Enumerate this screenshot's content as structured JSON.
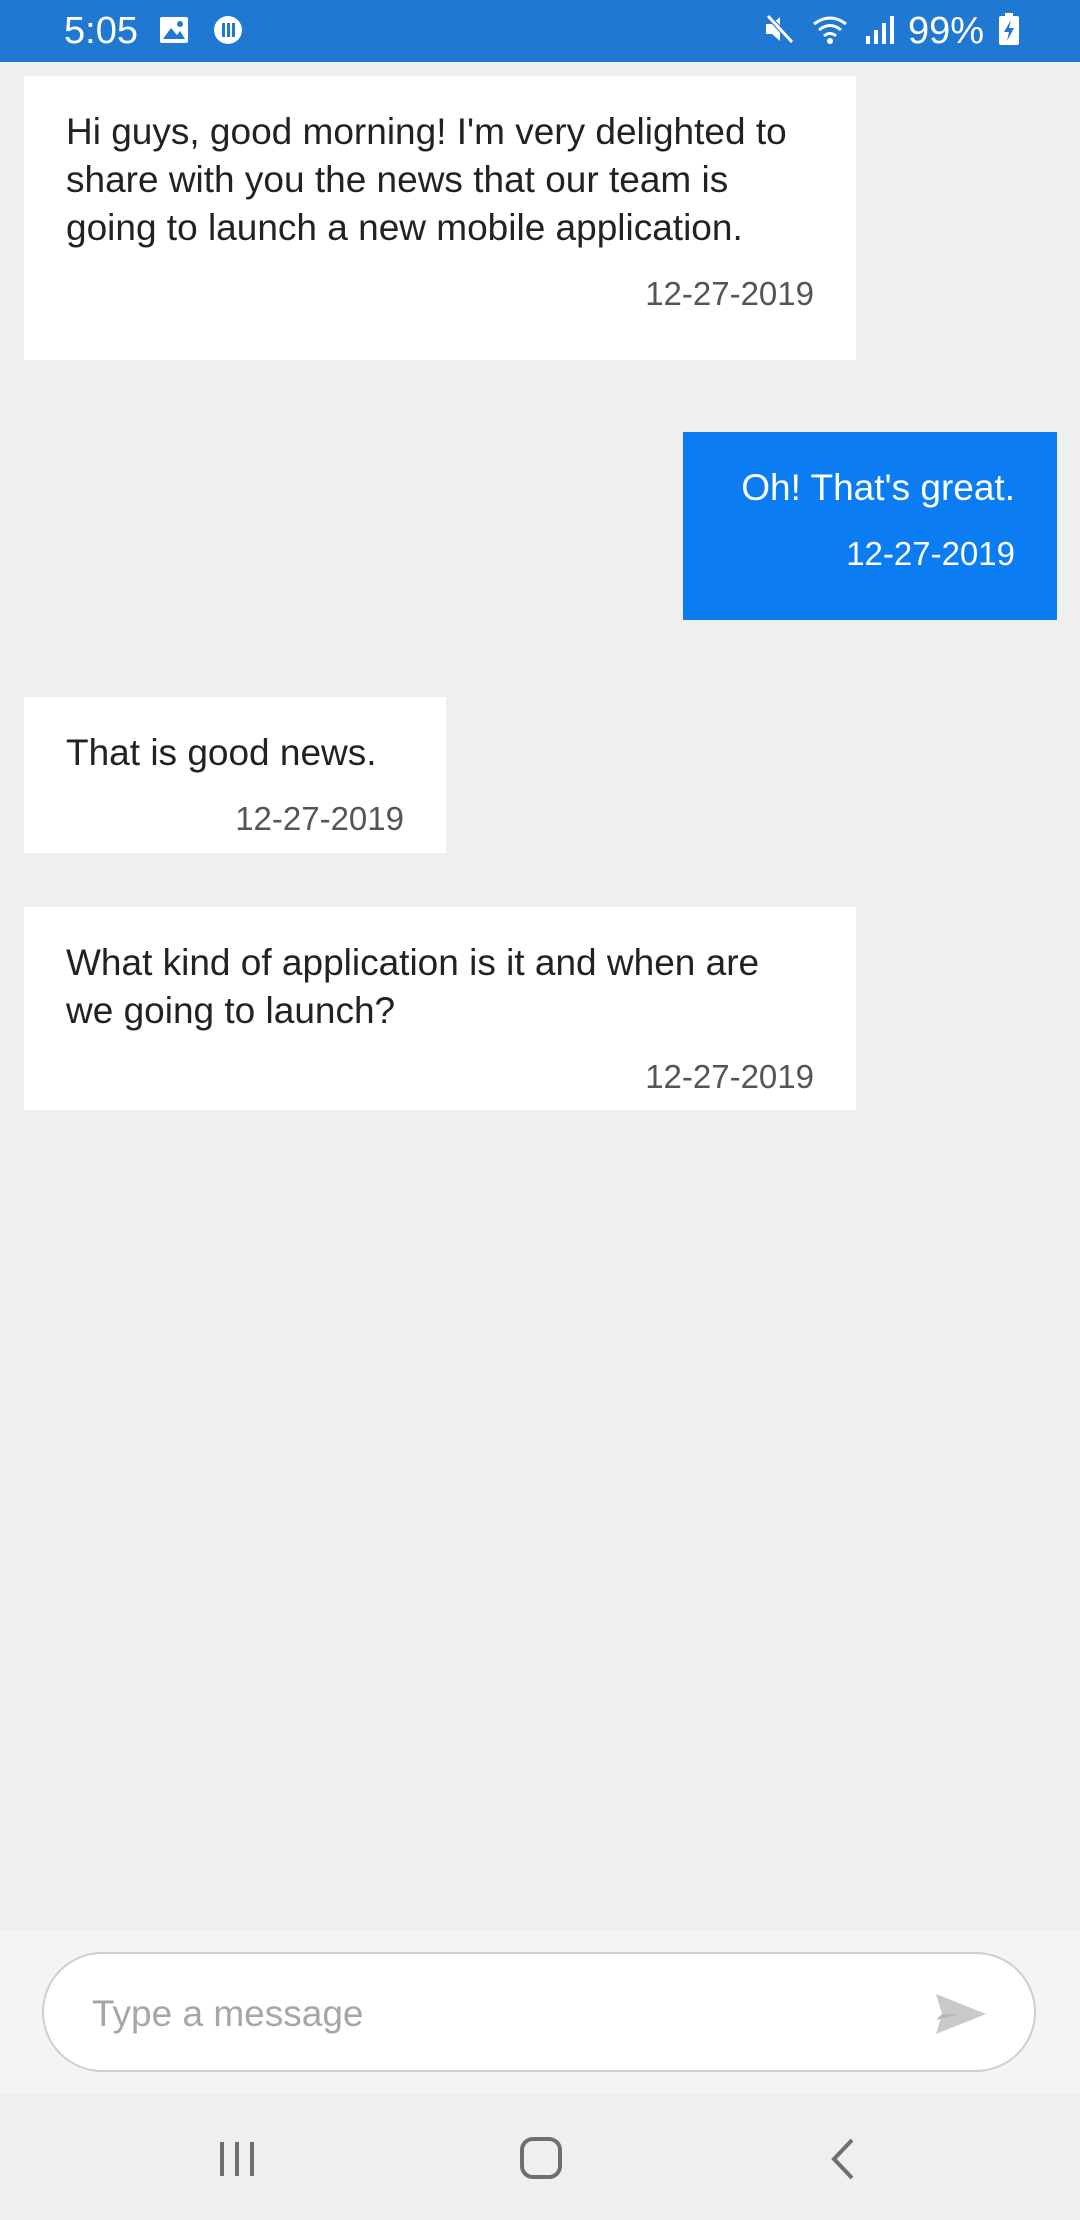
{
  "status_bar": {
    "time": "5:05",
    "battery_text": "99%",
    "color": "#1f78d1",
    "icons": [
      "gallery-icon",
      "notification-app-icon",
      "mute-icon",
      "wifi-icon",
      "signal-icon",
      "battery-charging-icon"
    ]
  },
  "messages": [
    {
      "direction": "incoming",
      "text": "Hi guys, good morning! I'm very delighted to share with you the news that our team is going to launch a new mobile application.",
      "date": "12-27-2019"
    },
    {
      "direction": "outgoing",
      "text": "Oh! That's great.",
      "date": "12-27-2019"
    },
    {
      "direction": "incoming",
      "text": "That is good news.",
      "date": "12-27-2019"
    },
    {
      "direction": "incoming",
      "text": "What kind of application is it and when are we going to launch?",
      "date": "12-27-2019"
    }
  ],
  "composer": {
    "placeholder": "Type a message",
    "value": "",
    "send_icon": "send-icon"
  },
  "nav_bar": {
    "buttons": [
      "recents-icon",
      "home-icon",
      "back-icon"
    ]
  },
  "colors": {
    "outgoing_bubble": "#0b7cf2",
    "incoming_bubble": "#ffffff",
    "background": "#efefef"
  }
}
